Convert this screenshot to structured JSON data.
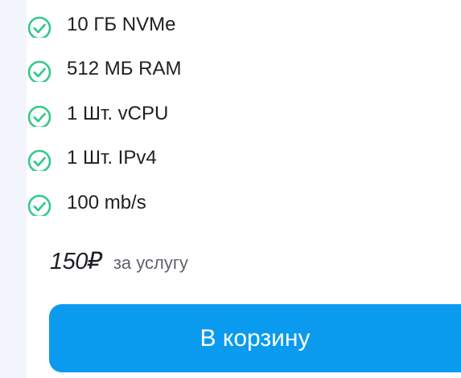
{
  "tariff": {
    "features": [
      {
        "icon": "check-circle-icon",
        "label": "10 ГБ NVMe"
      },
      {
        "icon": "check-circle-icon",
        "label": "512 МБ RAM"
      },
      {
        "icon": "check-circle-icon",
        "label": "1 Шт. vCPU"
      },
      {
        "icon": "check-circle-icon",
        "label": "1 Шт. IPv4"
      },
      {
        "icon": "check-circle-icon",
        "label": "100 mb/s"
      }
    ],
    "price": "150₽",
    "price_note": "за услугу",
    "cart_button_label": "В корзину"
  },
  "colors": {
    "accent": "#0a9bef",
    "check": "#34c98a",
    "text": "#1e1f24",
    "muted": "#5f636b",
    "page_background": "#f2f5fb"
  }
}
